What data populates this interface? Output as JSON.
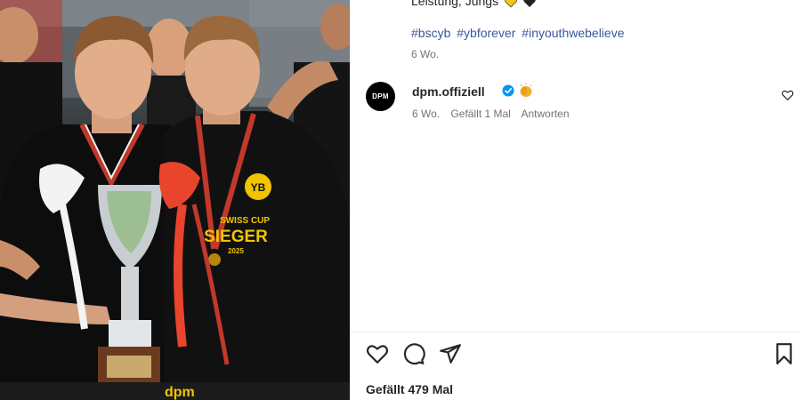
{
  "post": {
    "caption_tail": "Leistung, Jungs",
    "hashtags": [
      "#bscyb",
      "#ybforever",
      "#inyouthwebelieve"
    ],
    "caption_time": "6 Wo.",
    "likes_text": "Gefällt 479 Mal"
  },
  "photo": {
    "shirt_text_top": "SWISS CUP",
    "shirt_text_mid": "SIEGER",
    "shirt_text_year": "2025",
    "crest_text": "YB",
    "banner_text": "dpm"
  },
  "comment": {
    "avatar_text": "DPM",
    "username": "dpm.offiziell",
    "time": "6 Wo.",
    "likes": "Gefällt 1 Mal",
    "reply_label": "Antworten"
  },
  "colors": {
    "link": "#385898",
    "verified": "#0095f6",
    "muted": "#737373",
    "text": "#262626"
  },
  "icons": {
    "like": "heart-icon",
    "comment": "comment-icon",
    "share": "paper-plane-icon",
    "save": "bookmark-icon",
    "verified": "verified-badge-icon",
    "clap": "clapping-hands-emoji-icon"
  }
}
